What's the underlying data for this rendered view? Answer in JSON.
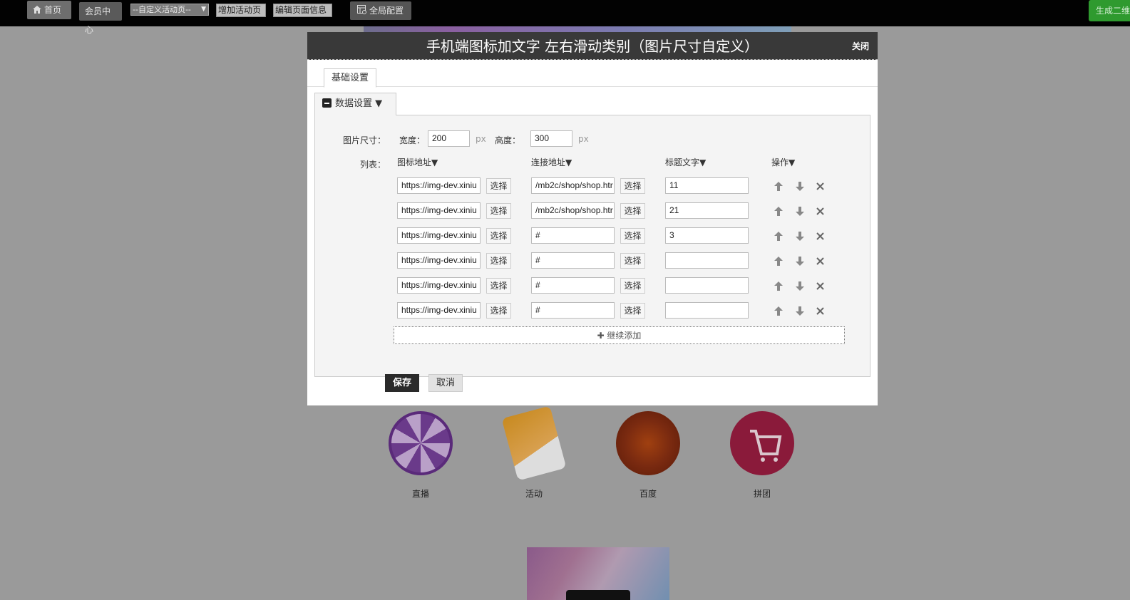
{
  "topbar": {
    "home_label": "首页",
    "member_label": "会员中心",
    "page_select_value": "--自定义活动页--",
    "add_page_label": "增加活动页",
    "edit_page_label": "编辑页面信息",
    "global_config_label": "全局配置",
    "qr_label": "生成二维码"
  },
  "background": {
    "icons": [
      {
        "label": "直播"
      },
      {
        "label": "活动"
      },
      {
        "label": "百度"
      },
      {
        "label": "拼团"
      }
    ]
  },
  "modal": {
    "title": "手机端图标加文字 左右滑动类别（图片尺寸自定义）",
    "close_label": "关闭",
    "tab_label": "基础设置",
    "section_label": "数据设置 ▼",
    "size_label": "图片尺寸：",
    "width_label": "宽度：",
    "width_value": "200",
    "height_label": "高度：",
    "height_value": "300",
    "unit": "px",
    "list_label": "列表：",
    "columns": {
      "icon": "图标地址▼",
      "link": "连接地址▼",
      "title": "标题文字▼",
      "ops": "操作▼"
    },
    "pick_label": "选择",
    "rows": [
      {
        "icon": "https://img-dev.xiniu",
        "link": "/mb2c/shop/shop.htr",
        "title": "11"
      },
      {
        "icon": "https://img-dev.xiniu",
        "link": "/mb2c/shop/shop.htr",
        "title": "21"
      },
      {
        "icon": "https://img-dev.xiniu",
        "link": "#",
        "title": "3"
      },
      {
        "icon": "https://img-dev.xiniu",
        "link": "#",
        "title": ""
      },
      {
        "icon": "https://img-dev.xiniu",
        "link": "#",
        "title": ""
      },
      {
        "icon": "https://img-dev.xiniu",
        "link": "#",
        "title": ""
      }
    ],
    "add_more_label": "继续添加",
    "save_label": "保存",
    "cancel_label": "取消"
  }
}
